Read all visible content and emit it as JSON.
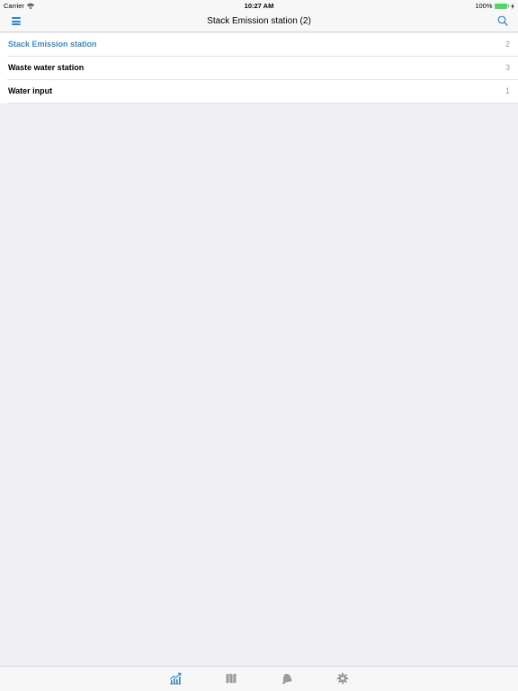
{
  "status_bar": {
    "carrier": "Carrier",
    "time": "10:27 AM",
    "battery": "100%",
    "battery_level": 1.0
  },
  "nav_bar": {
    "title": "Stack Emission station (2)",
    "left_icon": "menu-icon",
    "right_icon": "search-icon"
  },
  "list": {
    "items": [
      {
        "label": "Stack Emission station",
        "count": "2",
        "active": true
      },
      {
        "label": "Waste water station",
        "count": "3",
        "active": false
      },
      {
        "label": "Water input",
        "count": "1",
        "active": false
      }
    ]
  },
  "tab_bar": {
    "tabs": [
      {
        "icon": "chart-icon",
        "selected": true
      },
      {
        "icon": "map-icon",
        "selected": false
      },
      {
        "icon": "bell-icon",
        "selected": false
      },
      {
        "icon": "gear-icon",
        "selected": false
      }
    ]
  },
  "colors": {
    "accent": "#2b86c9",
    "active_text": "#3b8bc8",
    "inactive_icon": "#9b9b9b",
    "battery": "#4cd964",
    "background": "#efeff4"
  }
}
